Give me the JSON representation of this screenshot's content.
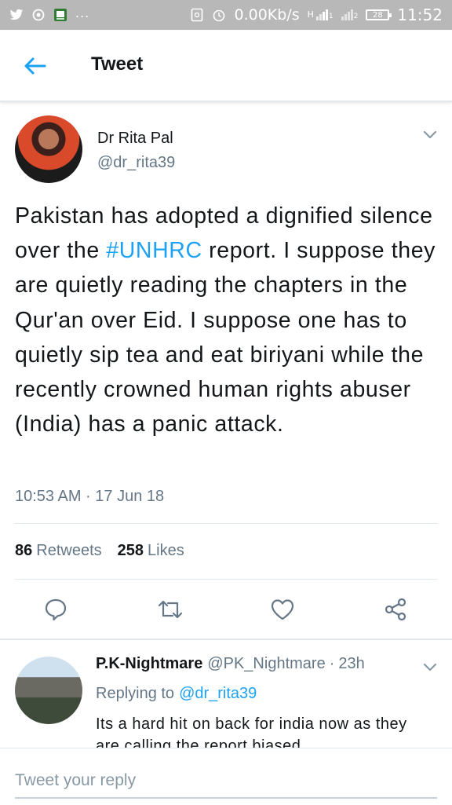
{
  "status_bar": {
    "speed": "0.00Kb/s",
    "time": "11:52",
    "battery": "28",
    "dots": "...",
    "network_h": "H",
    "sim1": "1",
    "sim2": "2"
  },
  "header": {
    "title": "Tweet"
  },
  "tweet": {
    "author_name": "Dr Rita Pal",
    "author_handle": "@dr_rita39",
    "text_before": "Pakistan has adopted a dignified silence over the ",
    "hashtag": "#UNHRC",
    "text_after": " report. I suppose they are quietly reading the chapters in the Qur'an over Eid. I suppose one has to quietly sip tea and eat biriyani while the recently crowned human rights abuser (India) has a panic attack.",
    "timestamp": "10:53 AM · 17 Jun 18",
    "retweets_count": "86",
    "retweets_label": "Retweets",
    "likes_count": "258",
    "likes_label": "Likes"
  },
  "reply": {
    "name": "P.K-Nightmare",
    "handle": "@PK_Nightmare",
    "separator": "·",
    "time": "23h",
    "replying_label": "Replying to",
    "replying_to": "@dr_rita39",
    "text": "Its a hard hit on back for india now as they are calling the report biased"
  },
  "compose": {
    "placeholder": "Tweet your reply",
    "value": ""
  },
  "colors": {
    "accent": "#1da1f2",
    "secondary_text": "#657786",
    "status_bar": "#b8b8b8"
  }
}
